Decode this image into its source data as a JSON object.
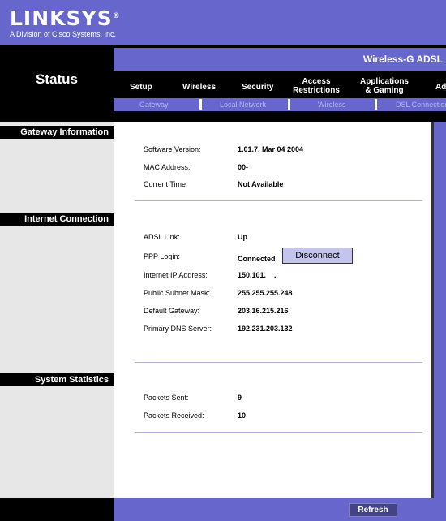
{
  "brand": {
    "name": "LINKSYS",
    "mark": "®",
    "tagline": "A Division of Cisco Systems, Inc."
  },
  "product": "Wireless-G ADSL",
  "page_title": "Status",
  "tabs": [
    {
      "label": "Setup"
    },
    {
      "label": "Wireless"
    },
    {
      "label": "Security"
    },
    {
      "label": "Access\nRestrictions"
    },
    {
      "label": "Applications\n& Gaming"
    },
    {
      "label": "Ad"
    }
  ],
  "subtabs": [
    {
      "label": "Gateway"
    },
    {
      "label": "Local Network"
    },
    {
      "label": "Wireless"
    },
    {
      "label": "DSL Connection"
    }
  ],
  "sections": {
    "gateway": {
      "title": "Gateway Information",
      "rows": [
        {
          "label": "Software Version:",
          "value": "1.01.7, Mar 04 2004"
        },
        {
          "label": "MAC Address:",
          "value": "00-"
        },
        {
          "label": "Current Time:",
          "value": "Not Available"
        }
      ]
    },
    "internet": {
      "title": "Internet Connection",
      "rows": [
        {
          "label": "ADSL Link:",
          "value": "Up"
        },
        {
          "label": "PPP Login:",
          "value": "Connected"
        },
        {
          "label": "Internet IP Address:",
          "value": "150.101.    ."
        },
        {
          "label": "Public Subnet Mask:",
          "value": "255.255.255.248"
        },
        {
          "label": "Default Gateway:",
          "value": "203.16.215.216"
        },
        {
          "label": "Primary DNS Server:",
          "value": "192.231.203.132"
        }
      ],
      "disconnect_label": "Disconnect"
    },
    "stats": {
      "title": "System Statistics",
      "rows": [
        {
          "label": "Packets Sent:",
          "value": "9"
        },
        {
          "label": "Packets Received:",
          "value": "10"
        }
      ]
    }
  },
  "refresh_label": "Refresh",
  "colors": {
    "brand_purple": "#6666cc",
    "black": "#000000",
    "panel_gray": "#e7e7e7"
  }
}
